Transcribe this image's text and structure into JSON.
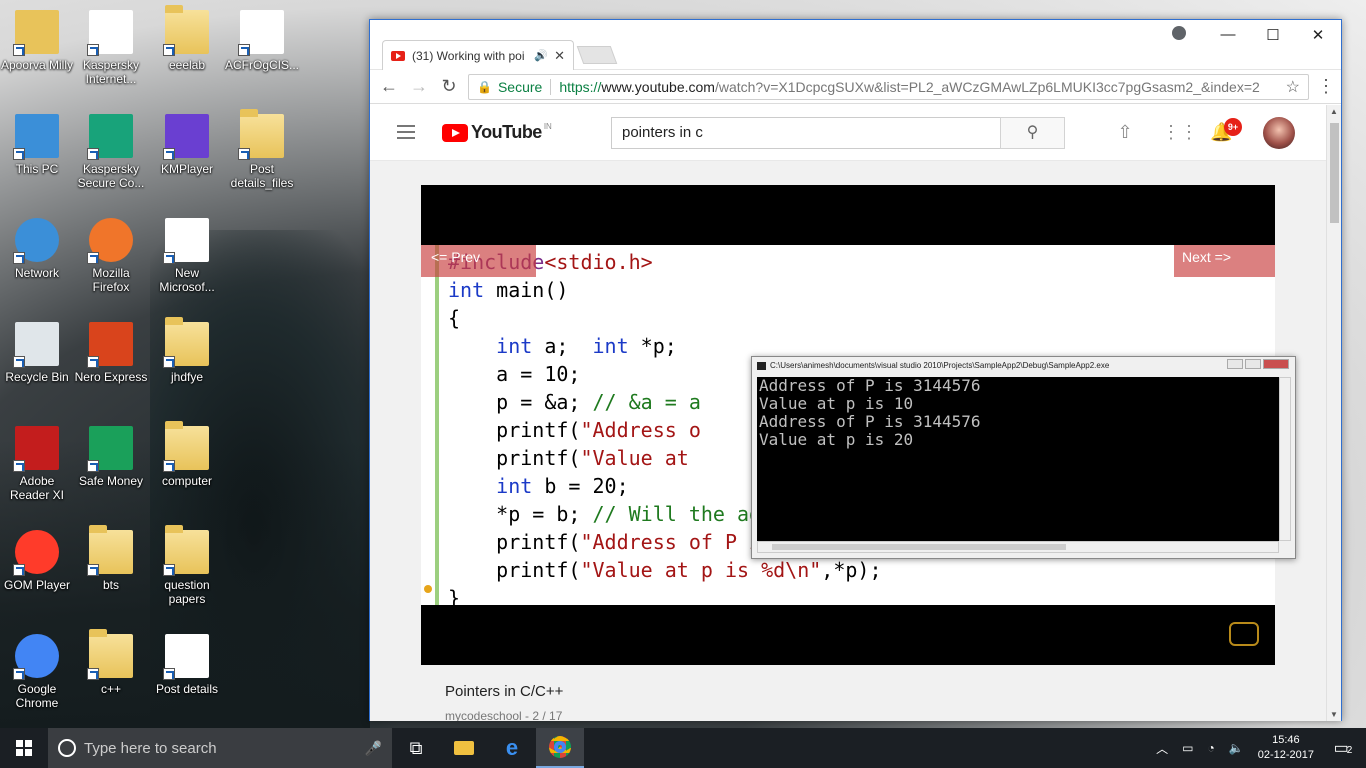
{
  "desktop": {
    "icons": [
      {
        "label": "Apoorva Milly",
        "icon": "user-folder-icon"
      },
      {
        "label": "Kaspersky Internet...",
        "icon": "kaspersky-icon"
      },
      {
        "label": "eeelab",
        "icon": "folder-icon"
      },
      {
        "label": "ACFrOgCIS...",
        "icon": "pdf-icon"
      },
      {
        "label": "This PC",
        "icon": "computer-icon"
      },
      {
        "label": "Kaspersky Secure Co...",
        "icon": "kaspersky-secure-icon"
      },
      {
        "label": "KMPlayer",
        "icon": "kmplayer-icon"
      },
      {
        "label": "Post details_files",
        "icon": "folder-icon"
      },
      {
        "label": "Network",
        "icon": "network-icon"
      },
      {
        "label": "Mozilla Firefox",
        "icon": "firefox-icon"
      },
      {
        "label": "New Microsof...",
        "icon": "word-icon"
      },
      {
        "label": "Recycle Bin",
        "icon": "recycle-bin-icon"
      },
      {
        "label": "Nero Express",
        "icon": "nero-icon"
      },
      {
        "label": "jhdfye",
        "icon": "folder-icon"
      },
      {
        "label": "Adobe Reader XI",
        "icon": "adobe-icon"
      },
      {
        "label": "Safe Money",
        "icon": "safe-money-icon"
      },
      {
        "label": "computer",
        "icon": "folder-icon"
      },
      {
        "label": "GOM Player",
        "icon": "gom-icon"
      },
      {
        "label": "bts",
        "icon": "folder-icon"
      },
      {
        "label": "question papers",
        "icon": "folder-icon"
      },
      {
        "label": "Google Chrome",
        "icon": "chrome-icon"
      },
      {
        "label": "c++",
        "icon": "folder-icon"
      },
      {
        "label": "Post details",
        "icon": "edge-icon"
      }
    ]
  },
  "browser": {
    "tab_title": "(31) Working with poi",
    "secure_label": "Secure",
    "url_scheme": "https://",
    "url_host": "www.youtube.com",
    "url_rest": "/watch?v=X1DcpcgSUXw&list=PL2_aWCzGMAwLZp6LMUKI3cc7pgGsasm2_&index=2"
  },
  "youtube": {
    "country": "IN",
    "logo_word": "YouTube",
    "search_value": "pointers in c",
    "notification_count": "9+",
    "video_title": "Pointers in C/C++",
    "channel_line": "mycodeschool - 2 / 17"
  },
  "player": {
    "prev_label": "<= Prev",
    "next_label": "Next =>"
  },
  "console": {
    "title": "C:\\Users\\animesh\\documents\\visual studio 2010\\Projects\\SampleApp2\\Debug\\SampleApp2.exe",
    "output": "Address of P is 3144576\nValue at p is 10\nAddress of P is 3144576\nValue at p is 20"
  },
  "taskbar": {
    "search_placeholder": "Type here to search",
    "time": "15:46",
    "date": "02-12-2017",
    "notifications": "2"
  }
}
